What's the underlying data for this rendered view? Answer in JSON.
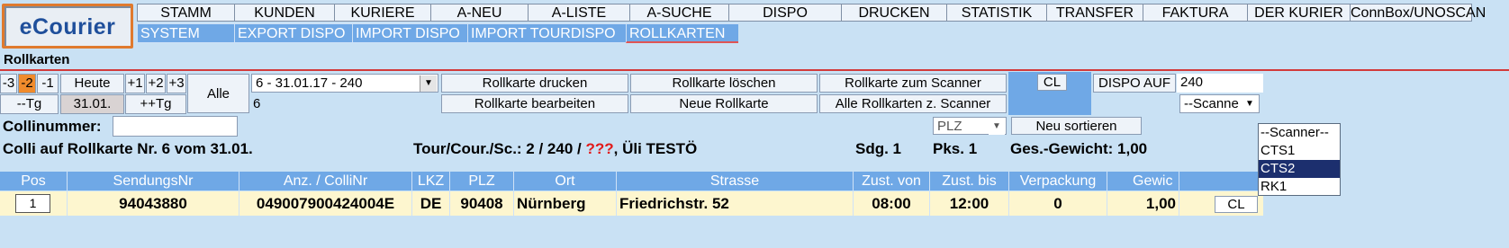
{
  "app": {
    "logo": "eCourier"
  },
  "menu_top": [
    {
      "label": "STAMM",
      "w": 108
    },
    {
      "label": "KUNDEN",
      "w": 111
    },
    {
      "label": "KURIERE",
      "w": 107
    },
    {
      "label": "A-NEU",
      "w": 108
    },
    {
      "label": "A-LISTE",
      "w": 113
    },
    {
      "label": "A-SUCHE",
      "w": 110
    },
    {
      "label": "DISPO",
      "w": 125
    },
    {
      "label": "DRUCKEN",
      "w": 117
    },
    {
      "label": "STATISTIK",
      "w": 111
    },
    {
      "label": "TRANSFER",
      "w": 107
    },
    {
      "label": "FAKTURA",
      "w": 116
    },
    {
      "label": "DER KURIER",
      "w": 114
    },
    {
      "label": "ConnBox/UNOSCAN",
      "w": 136
    }
  ],
  "menu_sub": [
    {
      "label": "SYSTEM",
      "w": 108
    },
    {
      "label": "EXPORT DISPO",
      "w": 131
    },
    {
      "label": "IMPORT DISPO",
      "w": 128
    },
    {
      "label": "IMPORT TOURDISPO",
      "w": 176
    },
    {
      "label": "ROLLKARTEN",
      "w": 125,
      "active": true
    }
  ],
  "page_title": "Rollkarten",
  "day_buttons": [
    "-3",
    "-2",
    "-1"
  ],
  "day_plus": [
    "+1",
    "+2",
    "+3"
  ],
  "heute": "Heute",
  "minus_tg": "--Tg",
  "date": "31.01.",
  "plus_tg": "++Tg",
  "alle": "Alle",
  "rollkarte_select": "6 - 31.01.17 - 240",
  "rollkarte_nr_field": "6",
  "actions": {
    "drucken": "Rollkarte drucken",
    "loeschen": "Rollkarte löschen",
    "zum_scanner": "Rollkarte zum Scanner",
    "bearbeiten": "Rollkarte bearbeiten",
    "neue": "Neue Rollkarte",
    "alle_scanner": "Alle Rollkarten z. Scanner"
  },
  "cl": "CL",
  "dispo_auf_label": "DISPO AUF",
  "dispo_auf_value": "240",
  "scanner_select": "--Scanne",
  "scanner_options": [
    "--Scanner--",
    "CTS1",
    "CTS2",
    "RK1"
  ],
  "scanner_highlight": "CTS2",
  "collinummer_label": "Collinummer:",
  "plz_select": "PLZ",
  "neu_sortieren": "Neu sortieren",
  "info": {
    "colli_text": "Colli auf Rollkarte Nr. 6 vom 31.01.",
    "tour_prefix": "Tour/Cour./Sc.: 2 / 240 /",
    "tour_unknown": "???",
    "tour_suffix": ", Üli TESTÖ",
    "sdg": "Sdg. 1",
    "pks": "Pks. 1",
    "gewicht": "Ges.-Gewicht: 1,00"
  },
  "table": {
    "headers": [
      "Pos",
      "SendungsNr",
      "Anz. / ColliNr",
      "LKZ",
      "PLZ",
      "Ort",
      "Strasse",
      "Zust. von",
      "Zust. bis",
      "Verpackung",
      "Gewic"
    ],
    "row": {
      "pos": "1",
      "sendungsnr": "94043880",
      "colli": "049007900424004E",
      "lkz": "DE",
      "plz": "90408",
      "ort": "Nürnberg",
      "strasse": "Friedrichstr. 52",
      "von": "08:00",
      "bis": "12:00",
      "verpackung": "0",
      "gewicht": "1,00",
      "cl": "CL"
    }
  }
}
